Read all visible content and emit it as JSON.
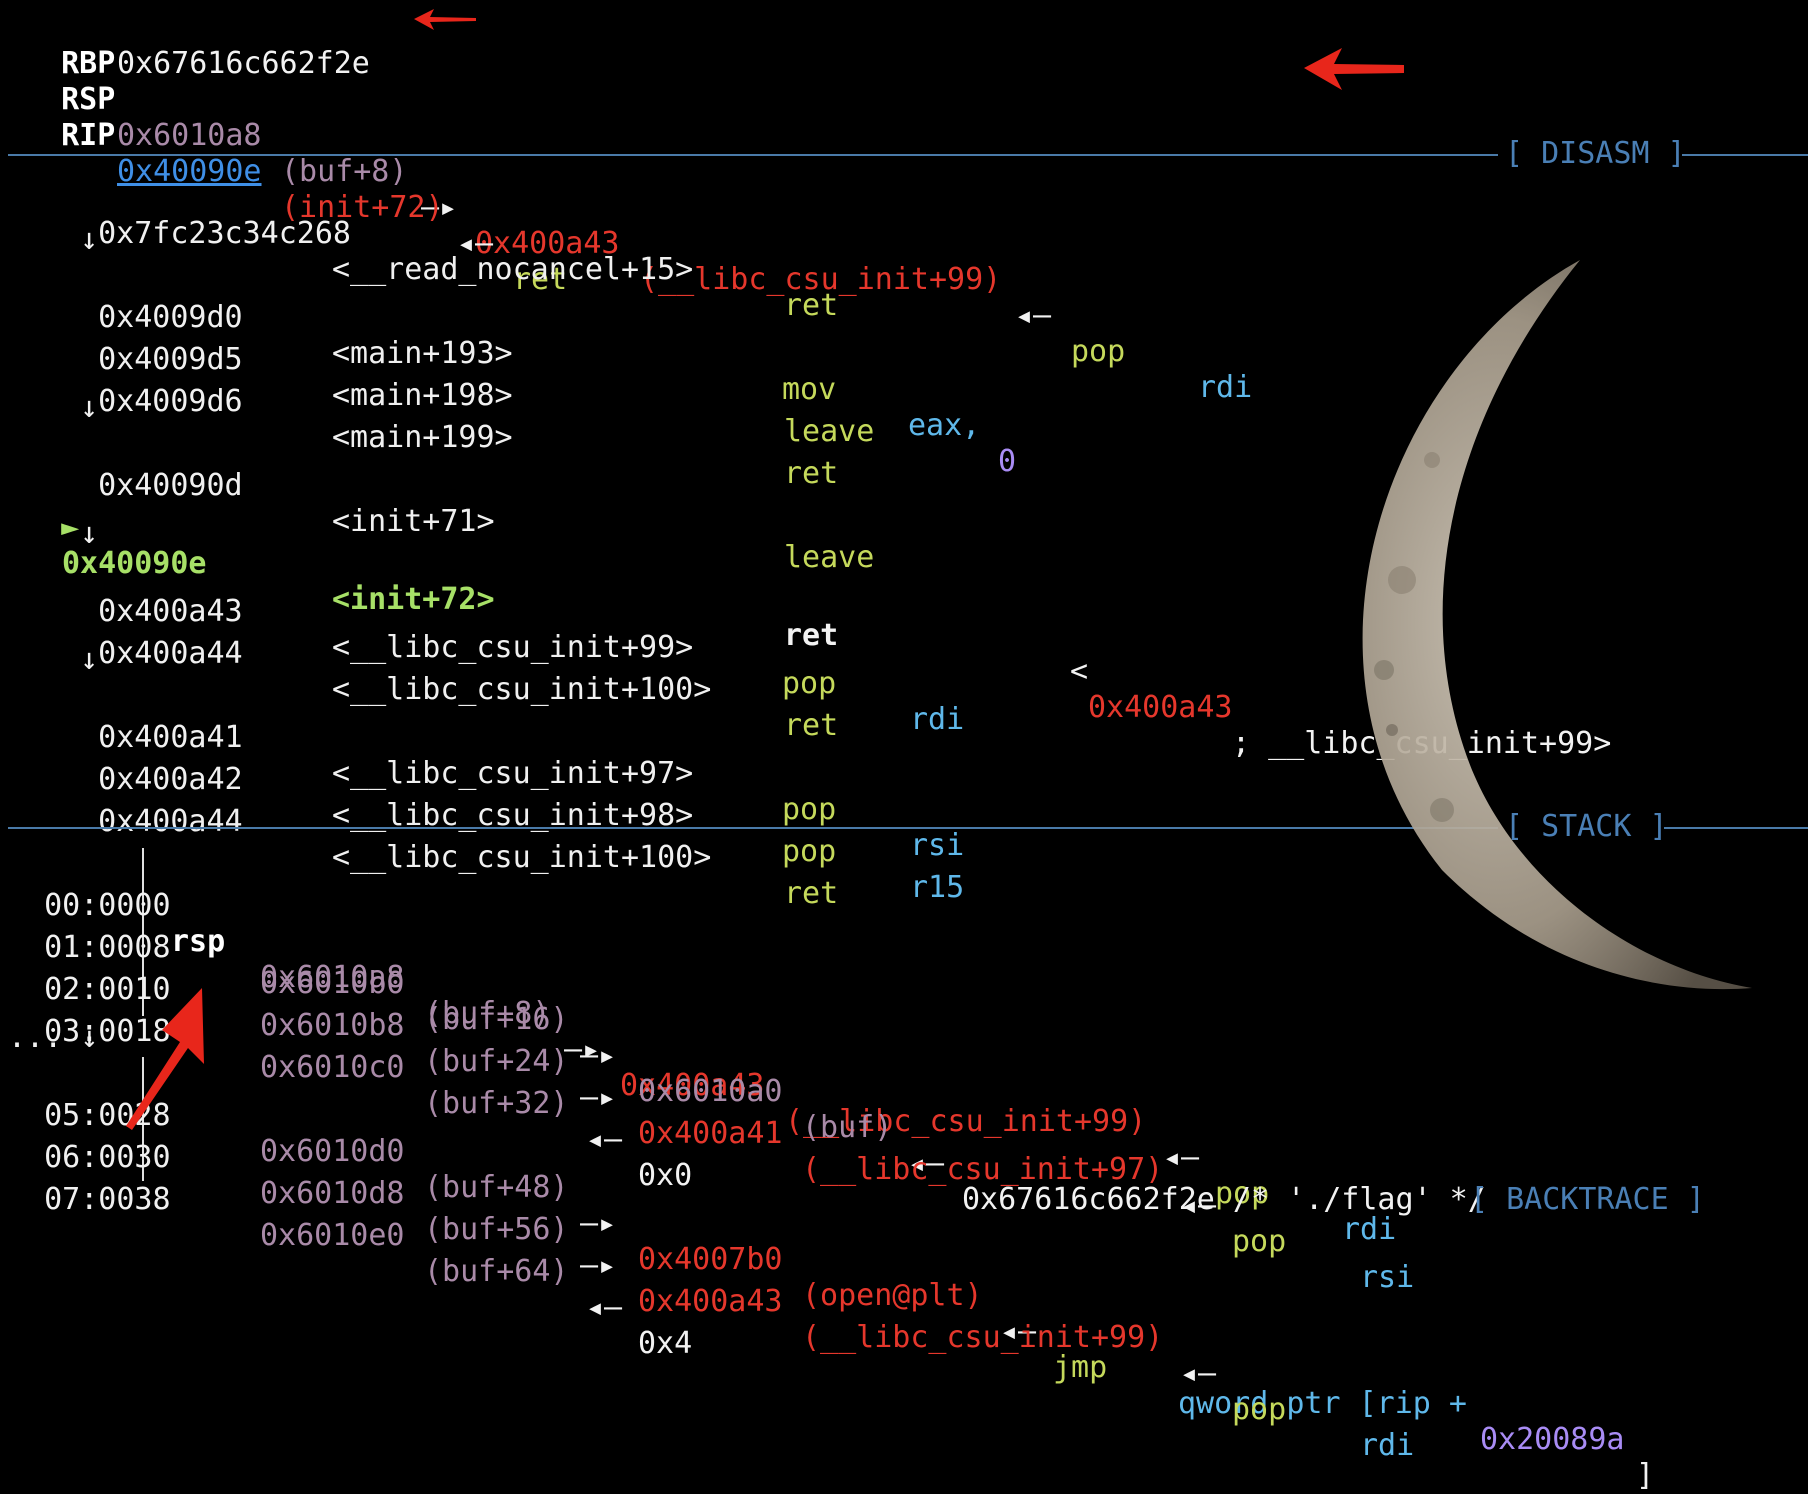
{
  "registers": {
    "rbp": {
      "name": "RBP",
      "value": "0x67616c662f2e"
    },
    "rsp": {
      "name": "RSP",
      "addr": "0x6010a8",
      "sym": "(buf+8)",
      "arrow": "—▸",
      "target": "0x400a43",
      "target_sym": "(__libc_csu_init+99)",
      "back": "◂—",
      "insn": "pop",
      "operand": "rdi"
    },
    "rip": {
      "name": "RIP",
      "addr": "0x40090e",
      "sym": "(init+72)",
      "back": "◂—",
      "insn": "ret"
    }
  },
  "disasm": {
    "header": "[ DISASM ]",
    "down_arrow": "↓",
    "current_marker": "►",
    "rows": [
      {
        "addr": "0x7fc23c34c268",
        "sym": "<__read_nocancel+15>",
        "insn": "ret",
        "op": ""
      },
      {
        "addr": "0x4009d0",
        "sym": "<main+193>",
        "insn": "mov",
        "op1": "eax,",
        "op2": "0"
      },
      {
        "addr": "0x4009d5",
        "sym": "<main+198>",
        "insn": "leave"
      },
      {
        "addr": "0x4009d6",
        "sym": "<main+199>",
        "insn": "ret"
      },
      {
        "addr": "0x40090d",
        "sym": "<init+71>",
        "insn": "leave"
      },
      {
        "addr": "0x40090e",
        "sym": "<init+72>",
        "insn": "ret",
        "comment_open": "<",
        "comment_addr": "0x400a43",
        "comment_rest": "; __libc_csu_init+99>"
      },
      {
        "addr": "0x400a43",
        "sym": "<__libc_csu_init+99>",
        "insn": "pop",
        "op": "rdi"
      },
      {
        "addr": "0x400a44",
        "sym": "<__libc_csu_init+100>",
        "insn": "ret"
      },
      {
        "addr": "0x400a41",
        "sym": "<__libc_csu_init+97>",
        "insn": "pop",
        "op": "rsi"
      },
      {
        "addr": "0x400a42",
        "sym": "<__libc_csu_init+98>",
        "insn": "pop",
        "op": "r15"
      },
      {
        "addr": "0x400a44",
        "sym": "<__libc_csu_init+100>",
        "insn": "ret"
      }
    ]
  },
  "stack": {
    "header": "[ STACK ]",
    "rows": [
      {
        "idx": "00:0000",
        "reg": "rsp",
        "addr": "0x6010a8",
        "sym": "(buf+8)",
        "arrow": "—▸",
        "target": "0x400a43",
        "target_sym": "(__libc_csu_init+99)",
        "back": "◂—",
        "insn": "pop",
        "op": "rdi"
      },
      {
        "idx": "01:0008",
        "addr": "0x6010b0",
        "sym": "(buf+16)",
        "arrow": "—▸",
        "target": "0x6010a0",
        "target_sym": "(buf)",
        "back": "◂—",
        "value": "0x67616c662f2e /* './flag' */"
      },
      {
        "idx": "02:0010",
        "addr": "0x6010b8",
        "sym": "(buf+24)",
        "arrow": "—▸",
        "target": "0x400a41",
        "target_sym": "(__libc_csu_init+97)",
        "back": "◂—",
        "insn": "pop",
        "op": "rsi"
      },
      {
        "idx": "03:0018",
        "addr": "0x6010c0",
        "sym": "(buf+32)",
        "back": "◂—",
        "value": "0x0"
      },
      {
        "idx": "... ↓"
      },
      {
        "idx": "05:0028",
        "addr": "0x6010d0",
        "sym": "(buf+48)",
        "arrow": "—▸",
        "target": "0x4007b0",
        "target_sym": "(open@plt)",
        "back": "◂—",
        "insn": "jmp",
        "op_a": "qword ptr [rip +",
        "op_b": "0x20089a",
        "op_c": "]"
      },
      {
        "idx": "06:0030",
        "addr": "0x6010d8",
        "sym": "(buf+56)",
        "arrow": "—▸",
        "target": "0x400a43",
        "target_sym": "(__libc_csu_init+99)",
        "back": "◂—",
        "insn": "pop",
        "op": "rdi"
      },
      {
        "idx": "07:0038",
        "addr": "0x6010e0",
        "sym": "(buf+64)",
        "back": "◂—",
        "value": "0x4"
      }
    ]
  },
  "backtrace": {
    "header": "[ BACKTRACE ]"
  },
  "colors": {
    "red": "#e5372c",
    "yellow": "#c5d95b",
    "blue": "#5fb8ea",
    "purple": "#a98cf5",
    "muted": "#a98aa8",
    "separator": "#4a7aa8"
  },
  "icons": [
    "red-pointer-arrow-icon",
    "moon-image"
  ]
}
